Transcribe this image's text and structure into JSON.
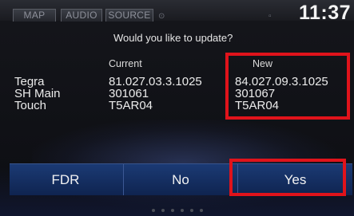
{
  "status_bar": {
    "tabs": [
      {
        "label": "MAP"
      },
      {
        "label": "AUDIO"
      },
      {
        "label": "SOURCE"
      }
    ],
    "clock": "11:37"
  },
  "dialog": {
    "question": "Would you like to update?",
    "headers": {
      "current": "Current",
      "new": "New"
    },
    "rows": [
      {
        "label": "Tegra",
        "current": "81.027.03.3.1025",
        "new": "84.027.09.3.1025"
      },
      {
        "label": "SH Main",
        "current": "301061",
        "new": "301067"
      },
      {
        "label": "Touch",
        "current": "T5AR04",
        "new": "T5AR04"
      }
    ]
  },
  "buttons": {
    "fdr": "FDR",
    "no": "No",
    "yes": "Yes"
  },
  "colors": {
    "highlight": "#e0131b",
    "button_bar": "#1b3a74"
  }
}
